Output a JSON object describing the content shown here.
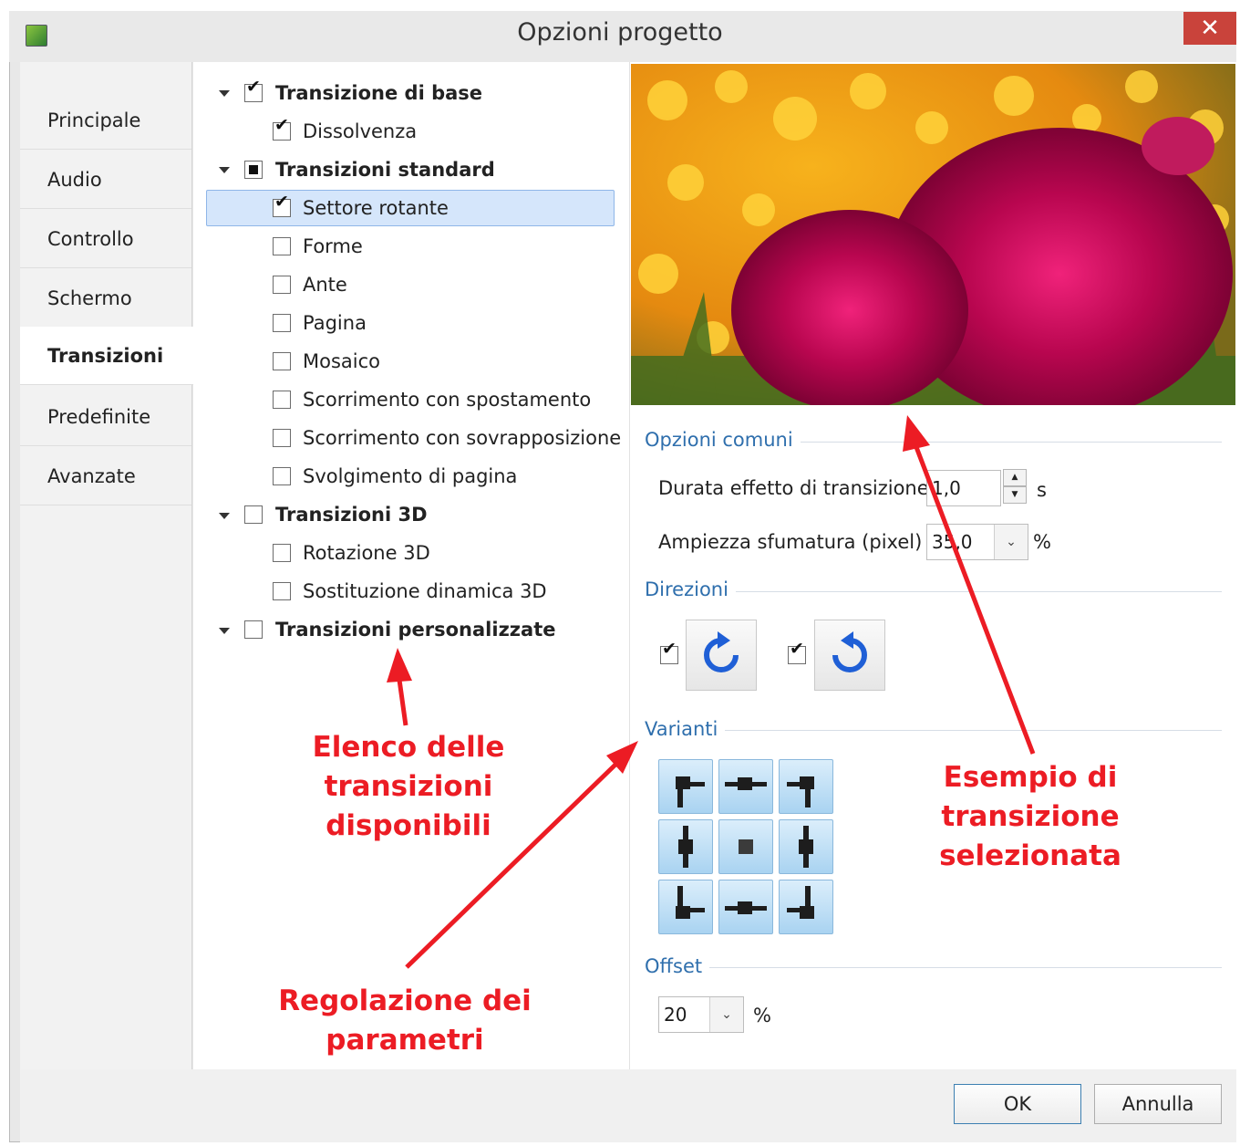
{
  "window": {
    "title": "Opzioni progetto",
    "close_label": "✕"
  },
  "sidebar": {
    "items": [
      {
        "label": "Principale"
      },
      {
        "label": "Audio"
      },
      {
        "label": "Controllo"
      },
      {
        "label": "Schermo"
      },
      {
        "label": "Transizioni",
        "active": true
      },
      {
        "label": "Predefinite"
      },
      {
        "label": "Avanzate"
      }
    ]
  },
  "tree": {
    "groups": [
      {
        "label": "Transizione di base",
        "state": "checked",
        "items": [
          {
            "label": "Dissolvenza",
            "checked": true
          }
        ]
      },
      {
        "label": "Transizioni standard",
        "state": "partial",
        "items": [
          {
            "label": "Settore rotante",
            "checked": true,
            "selected": true
          },
          {
            "label": "Forme",
            "checked": false
          },
          {
            "label": "Ante",
            "checked": false
          },
          {
            "label": "Pagina",
            "checked": false
          },
          {
            "label": "Mosaico",
            "checked": false
          },
          {
            "label": "Scorrimento con spostamento",
            "checked": false
          },
          {
            "label": "Scorrimento con sovrapposizione",
            "checked": false
          },
          {
            "label": "Svolgimento di pagina",
            "checked": false
          }
        ]
      },
      {
        "label": "Transizioni 3D",
        "state": "unchecked",
        "items": [
          {
            "label": "Rotazione 3D",
            "checked": false
          },
          {
            "label": "Sostituzione dinamica 3D",
            "checked": false
          }
        ]
      },
      {
        "label": "Transizioni personalizzate",
        "state": "unchecked",
        "items": []
      }
    ]
  },
  "options": {
    "common_title": "Opzioni comuni",
    "duration_label": "Durata effetto di transizione",
    "duration_value": "1,0",
    "duration_unit": "s",
    "blur_label": "Ampiezza sfumatura (pixel)",
    "blur_value": "35,0",
    "blur_unit": "%",
    "directions_title": "Direzioni",
    "direction_cw_checked": true,
    "direction_ccw_checked": true,
    "variants_title": "Varianti",
    "offset_title": "Offset",
    "offset_value": "20",
    "offset_unit": "%"
  },
  "buttons": {
    "ok": "OK",
    "cancel": "Annulla"
  },
  "annotations": {
    "list_note_line1": "Elenco delle transizioni",
    "list_note_line2": "disponibili",
    "params_note_line1": "Regolazione dei",
    "params_note_line2": "parametri",
    "example_note_line1": "Esempio di transizione",
    "example_note_line2": "selezionata"
  },
  "colors": {
    "accent": "#2f6fad",
    "annotation": "#ec1c24",
    "close": "#c9433b",
    "selection": "#d5e6fb"
  }
}
